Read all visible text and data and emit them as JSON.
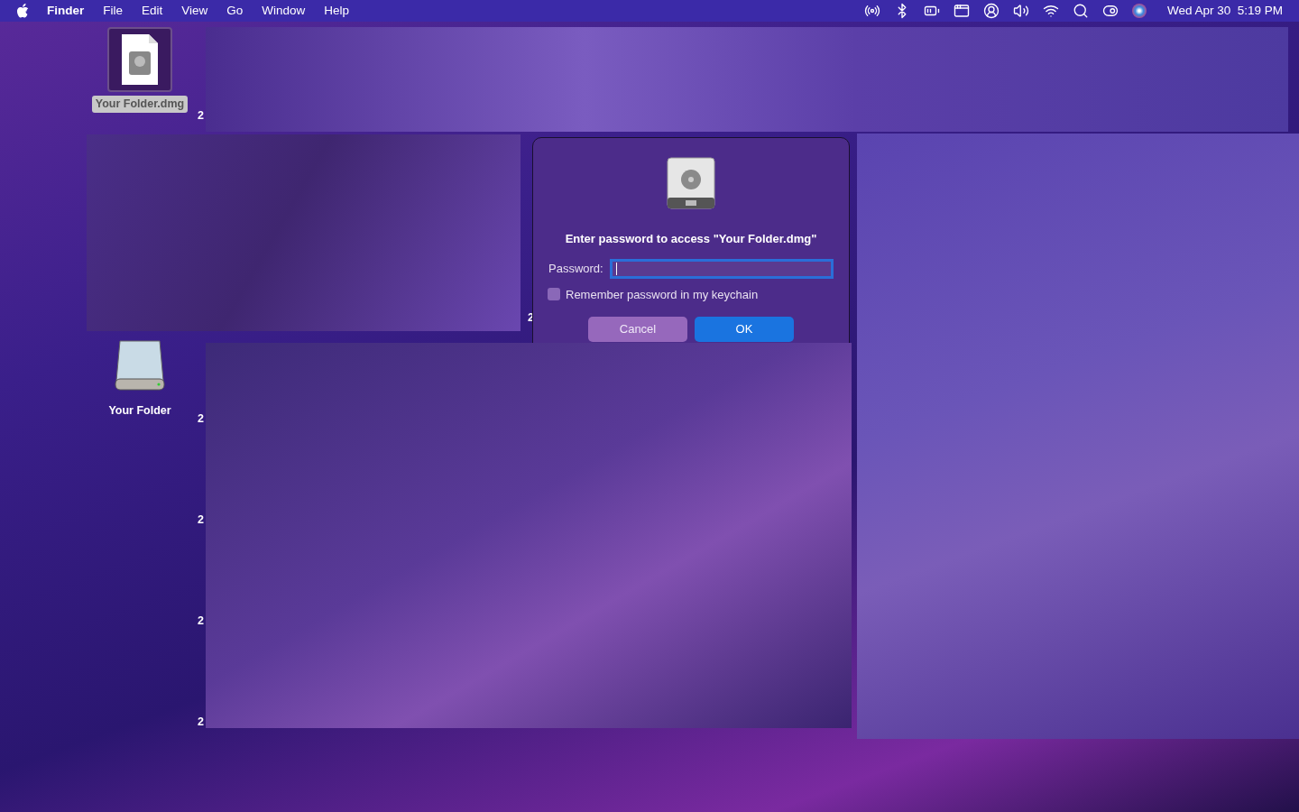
{
  "menu_bar": {
    "app_name": "Finder",
    "menus": [
      "File",
      "Edit",
      "View",
      "Go",
      "Window",
      "Help"
    ],
    "clock": "Wed Apr 30  5:19 PM"
  },
  "desktop_icons": [
    {
      "kind": "disk_image",
      "label": "Your Folder.dmg",
      "selected": true
    },
    {
      "kind": "drive",
      "label": "Your Folder",
      "selected": false
    }
  ],
  "partial_labels": [
    "2",
    "2",
    "2",
    "2",
    "2",
    "2"
  ],
  "dialog": {
    "message": "Enter password to access \"Your Folder.dmg\"",
    "password": {
      "label": "Password:",
      "focused": true
    },
    "remember": {
      "label": "Remember password in my keychain",
      "checked": false
    },
    "buttons": [
      {
        "label": "Cancel",
        "default": false
      },
      {
        "label": "OK",
        "default": true
      }
    ]
  }
}
